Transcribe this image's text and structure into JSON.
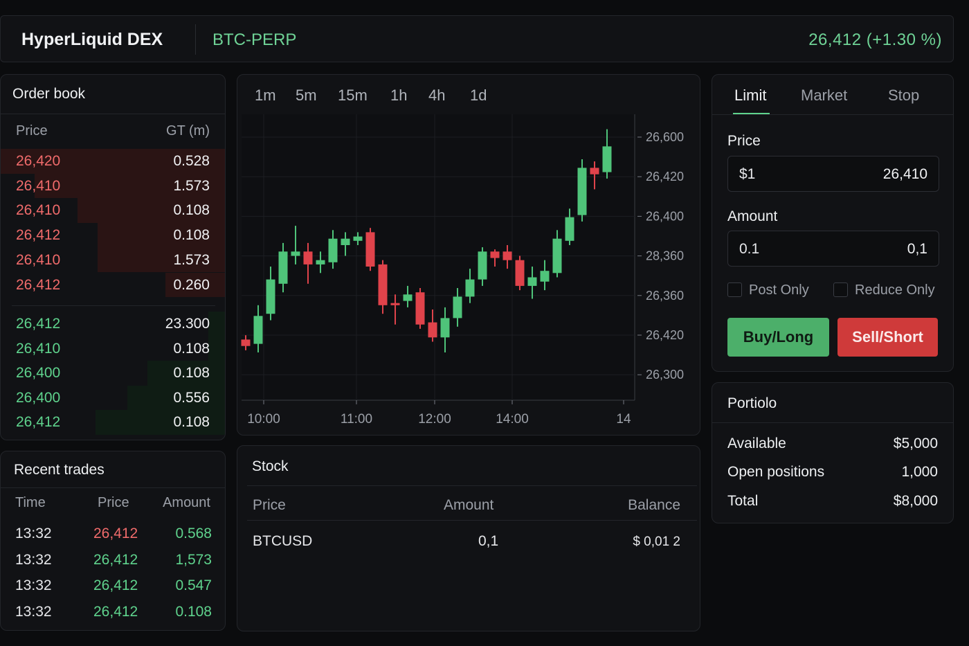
{
  "header": {
    "brand": "HyperLiquid DEX",
    "symbol": "BTC-PERP",
    "last_price": "26,412 (+1.30 %)"
  },
  "orderbook": {
    "title": "Order book",
    "col_price": "Price",
    "col_amount": "GT (m)",
    "asks": [
      {
        "price": "26,420",
        "amount": "0.528",
        "depth": 1.0
      },
      {
        "price": "26,410",
        "amount": "1.573",
        "depth": 0.85
      },
      {
        "price": "26,410",
        "amount": "0.108",
        "depth": 0.66
      },
      {
        "price": "26,412",
        "amount": "0.108",
        "depth": 0.57
      },
      {
        "price": "26,410",
        "amount": "1.573",
        "depth": 0.57
      },
      {
        "price": "26,412",
        "amount": "0.260",
        "depth": 0.27
      }
    ],
    "bids": [
      {
        "price": "26,412",
        "amount": "23.300",
        "depth": 0.08
      },
      {
        "price": "26,410",
        "amount": "0.108",
        "depth": 0.08
      },
      {
        "price": "26,400",
        "amount": "0.108",
        "depth": 0.35
      },
      {
        "price": "26,400",
        "amount": "0.556",
        "depth": 0.44
      },
      {
        "price": "26,412",
        "amount": "0.108",
        "depth": 0.58
      }
    ]
  },
  "trades": {
    "title": "Recent trades",
    "col_time": "Time",
    "col_price": "Price",
    "col_amount": "Amount",
    "rows": [
      {
        "time": "13:32",
        "price": "26,412",
        "amount": "0.568",
        "side": "sell"
      },
      {
        "time": "13:32",
        "price": "26,412",
        "amount": "1,573",
        "side": "buy"
      },
      {
        "time": "13:32",
        "price": "26,412",
        "amount": "0.547",
        "side": "buy"
      },
      {
        "time": "13:32",
        "price": "26,412",
        "amount": "0.108",
        "side": "buy"
      }
    ]
  },
  "timeframes": [
    "1m",
    "5m",
    "15m",
    "1h",
    "4h",
    "1d"
  ],
  "chart_data": {
    "type": "candlestick",
    "y_tick_labels": [
      "26,600",
      "26,420",
      "26,400",
      "28,360",
      "26,360",
      "26,420",
      "26,300"
    ],
    "x_tick_labels": [
      "10:00",
      "11:00",
      "12:00",
      "14:00",
      "14"
    ],
    "grid": true,
    "candles": [
      {
        "o": 0.13,
        "c": 0.16,
        "h": 0.18,
        "l": 0.11,
        "up": false
      },
      {
        "o": 0.14,
        "c": 0.27,
        "h": 0.32,
        "l": 0.1,
        "up": true
      },
      {
        "o": 0.28,
        "c": 0.44,
        "h": 0.5,
        "l": 0.25,
        "up": true
      },
      {
        "o": 0.42,
        "c": 0.57,
        "h": 0.61,
        "l": 0.38,
        "up": true
      },
      {
        "o": 0.55,
        "c": 0.57,
        "h": 0.69,
        "l": 0.51,
        "up": true
      },
      {
        "o": 0.57,
        "c": 0.51,
        "h": 0.61,
        "l": 0.42,
        "up": false
      },
      {
        "o": 0.51,
        "c": 0.53,
        "h": 0.57,
        "l": 0.47,
        "up": true
      },
      {
        "o": 0.52,
        "c": 0.63,
        "h": 0.67,
        "l": 0.49,
        "up": true
      },
      {
        "o": 0.6,
        "c": 0.63,
        "h": 0.66,
        "l": 0.55,
        "up": true
      },
      {
        "o": 0.62,
        "c": 0.64,
        "h": 0.66,
        "l": 0.6,
        "up": true
      },
      {
        "o": 0.66,
        "c": 0.5,
        "h": 0.68,
        "l": 0.48,
        "up": false
      },
      {
        "o": 0.51,
        "c": 0.32,
        "h": 0.53,
        "l": 0.28,
        "up": false
      },
      {
        "o": 0.32,
        "c": 0.33,
        "h": 0.37,
        "l": 0.23,
        "up": false
      },
      {
        "o": 0.34,
        "c": 0.37,
        "h": 0.41,
        "l": 0.31,
        "up": true
      },
      {
        "o": 0.38,
        "c": 0.23,
        "h": 0.4,
        "l": 0.21,
        "up": false
      },
      {
        "o": 0.24,
        "c": 0.17,
        "h": 0.3,
        "l": 0.15,
        "up": false
      },
      {
        "o": 0.17,
        "c": 0.26,
        "h": 0.31,
        "l": 0.1,
        "up": true
      },
      {
        "o": 0.26,
        "c": 0.36,
        "h": 0.4,
        "l": 0.22,
        "up": true
      },
      {
        "o": 0.36,
        "c": 0.44,
        "h": 0.49,
        "l": 0.33,
        "up": true
      },
      {
        "o": 0.44,
        "c": 0.57,
        "h": 0.59,
        "l": 0.41,
        "up": true
      },
      {
        "o": 0.57,
        "c": 0.54,
        "h": 0.58,
        "l": 0.5,
        "up": false
      },
      {
        "o": 0.57,
        "c": 0.53,
        "h": 0.6,
        "l": 0.49,
        "up": false
      },
      {
        "o": 0.53,
        "c": 0.41,
        "h": 0.55,
        "l": 0.39,
        "up": false
      },
      {
        "o": 0.41,
        "c": 0.45,
        "h": 0.5,
        "l": 0.35,
        "up": true
      },
      {
        "o": 0.43,
        "c": 0.48,
        "h": 0.53,
        "l": 0.39,
        "up": true
      },
      {
        "o": 0.47,
        "c": 0.63,
        "h": 0.67,
        "l": 0.45,
        "up": true
      },
      {
        "o": 0.62,
        "c": 0.73,
        "h": 0.77,
        "l": 0.6,
        "up": true
      },
      {
        "o": 0.74,
        "c": 0.96,
        "h": 1.0,
        "l": 0.71,
        "up": true
      },
      {
        "o": 0.96,
        "c": 0.93,
        "h": 0.99,
        "l": 0.86,
        "up": false
      },
      {
        "o": 0.94,
        "c": 1.06,
        "h": 1.14,
        "l": 0.91,
        "up": true
      }
    ]
  },
  "stock": {
    "title": "Stock",
    "col_price": "Price",
    "col_amount": "Amount",
    "col_balance": "Balance",
    "row": {
      "symbol": "BTCUSD",
      "amount": "0,1",
      "balance": "$ 0,01 2"
    }
  },
  "orderform": {
    "tabs": [
      "Limit",
      "Market",
      "Stop"
    ],
    "active_tab": "Limit",
    "price_label": "Price",
    "price_prefix": "$1",
    "price_value": "26,410",
    "amount_label": "Amount",
    "amount_prefix": "0.1",
    "amount_value": "0,1",
    "post_only": "Post Only",
    "reduce_only": "Reduce Only",
    "buy_label": "Buy/Long",
    "sell_label": "Sell/Short"
  },
  "portfolio": {
    "title": "Portiolo",
    "rows": [
      {
        "label": "Available",
        "value": "$5,000"
      },
      {
        "label": "Open positions",
        "value": "1,000"
      },
      {
        "label": "Total",
        "value": "$8,000"
      }
    ]
  },
  "colors": {
    "up": "#4fc47a",
    "down": "#e0434b",
    "ask_bg": "#2a1414",
    "bid_bg": "#0f1c14"
  }
}
